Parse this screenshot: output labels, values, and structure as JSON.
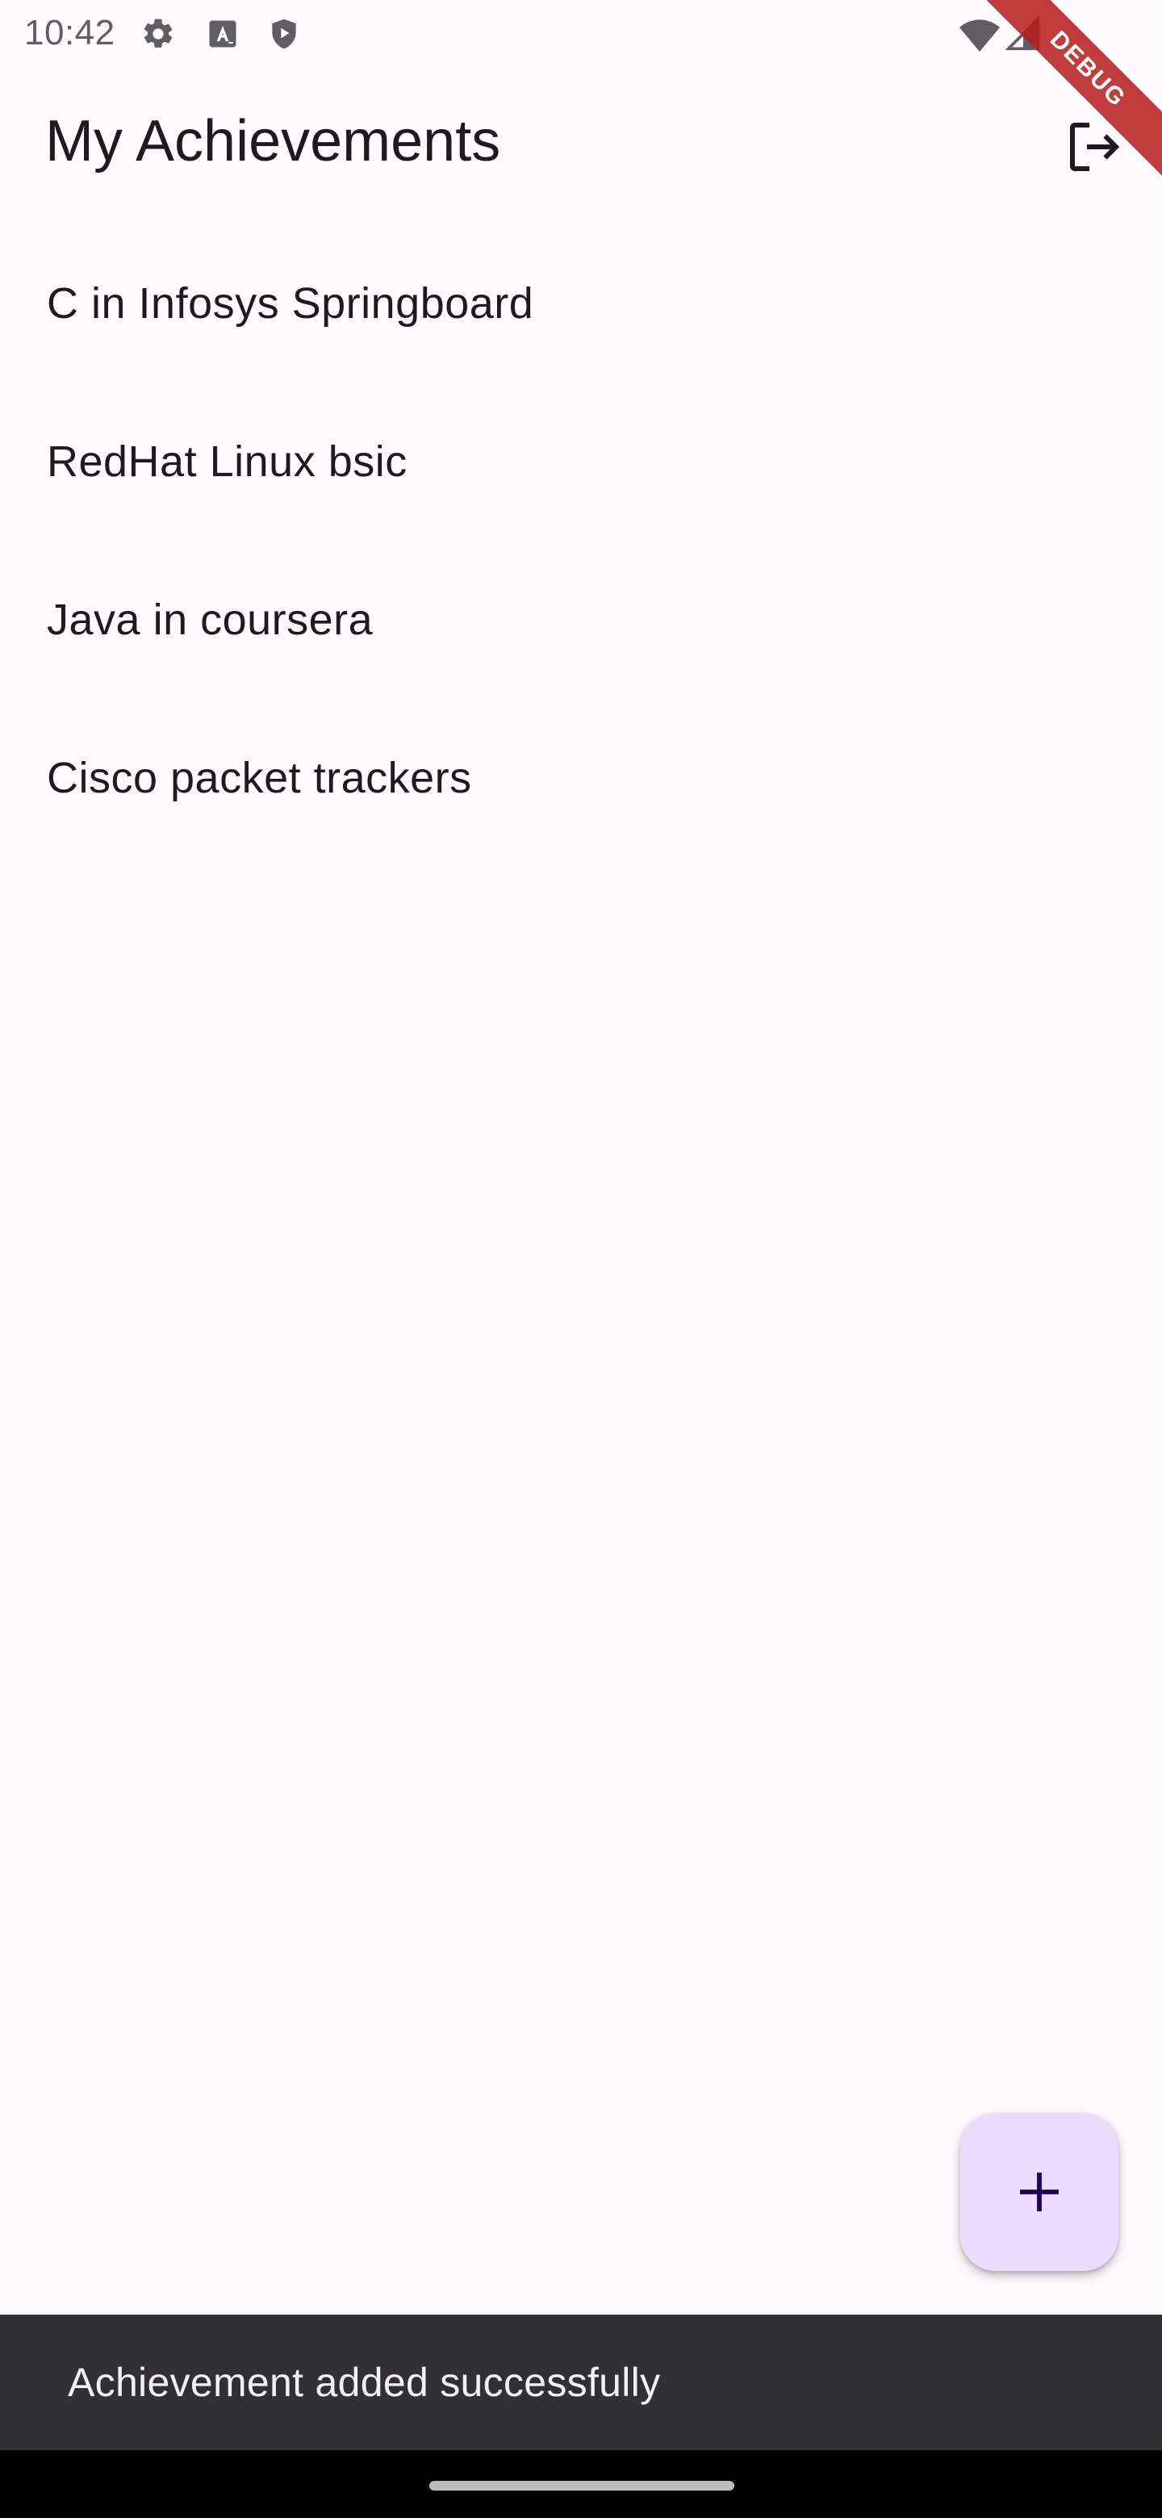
{
  "status_bar": {
    "time": "10:42",
    "icons": [
      "gear-icon",
      "a-icon",
      "shield-icon",
      "wifi-icon",
      "signal-icon"
    ]
  },
  "debug_banner": {
    "label": "DEBUG",
    "color": "#b71c1c"
  },
  "app_bar": {
    "title": "My Achievements",
    "action_icon": "logout-icon"
  },
  "achievements": [
    {
      "title": "C in Infosys Springboard"
    },
    {
      "title": "RedHat Linux bsic"
    },
    {
      "title": "Java in coursera"
    },
    {
      "title": "Cisco packet trackers"
    }
  ],
  "fab": {
    "icon": "plus-icon",
    "color": "#eaddff"
  },
  "snackbar": {
    "message": "Achievement added successfully"
  },
  "colors": {
    "background": "#fffbfe",
    "text": "#1d1b20",
    "snackbar_bg": "#313033",
    "fab_icon": "#21005d"
  }
}
